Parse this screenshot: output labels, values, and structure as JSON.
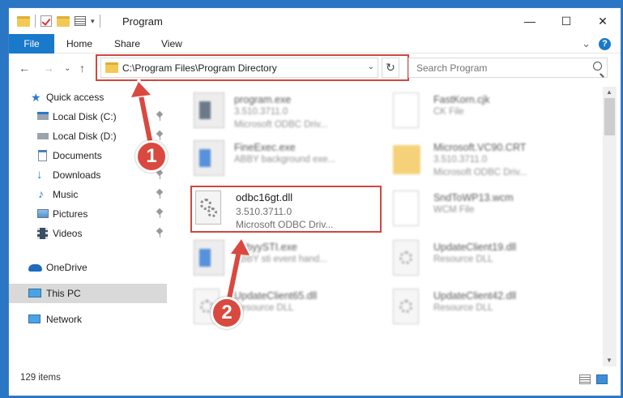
{
  "window": {
    "title": "Program",
    "minimize": "—",
    "maximize": "☐",
    "close": "✕"
  },
  "ribbon": {
    "file": "File",
    "home": "Home",
    "share": "Share",
    "view": "View",
    "expand": "⌄",
    "help": "?"
  },
  "nav": {
    "back": "←",
    "forward": "→",
    "recent": "⌄",
    "up": "↑",
    "address": "C:\\Program Files\\Program Directory",
    "address_dropdown": "⌄",
    "refresh": "↻",
    "search_placeholder": "Search Program"
  },
  "sidebar": {
    "items": [
      {
        "label": "Quick access",
        "icon": "star-icon",
        "pinned": false
      },
      {
        "label": "Local Disk (C:)",
        "icon": "drive-icon",
        "pinned": true
      },
      {
        "label": "Local Disk (D:)",
        "icon": "drive-icon",
        "pinned": true
      },
      {
        "label": "Documents",
        "icon": "documents-icon",
        "pinned": true
      },
      {
        "label": "Downloads",
        "icon": "download-icon",
        "pinned": true
      },
      {
        "label": "Music",
        "icon": "music-icon",
        "pinned": true
      },
      {
        "label": "Pictures",
        "icon": "pictures-icon",
        "pinned": true
      },
      {
        "label": "Videos",
        "icon": "videos-icon",
        "pinned": true
      },
      {
        "label": "OneDrive",
        "icon": "cloud-icon",
        "pinned": false
      },
      {
        "label": "This PC",
        "icon": "computer-icon",
        "pinned": false,
        "selected": true
      },
      {
        "label": "Network",
        "icon": "network-icon",
        "pinned": false
      }
    ]
  },
  "files": [
    {
      "name": "program.exe",
      "line2": "3.510.3711.0",
      "line3": "Microsoft ODBC Driv...",
      "icon": "app-icon"
    },
    {
      "name": "FastKorn.cjk",
      "line2": "CK File",
      "line3": "",
      "icon": "document-icon"
    },
    {
      "name": "FineExec.exe",
      "line2": "ABBY background exe...",
      "line3": "",
      "icon": "app-icon"
    },
    {
      "name": "Microsoft.VC90.CRT",
      "line2": "3.510.3711.0",
      "line3": "Microsoft ODBC Driv...",
      "icon": "folder-icon"
    },
    {
      "name": "odbc16gt.dll",
      "line2": "3.510.3711.0",
      "line3": "Microsoft ODBC Driv...",
      "icon": "dll-icon"
    },
    {
      "name": "SndToWP13.wcm",
      "line2": "WCM File",
      "line3": "",
      "icon": "document-icon"
    },
    {
      "name": "AbbyySTI.exe",
      "line2": "ABBY sti event hand...",
      "line3": "",
      "icon": "app-icon"
    },
    {
      "name": "UpdateClient19.dll",
      "line2": "Resource DLL",
      "line3": "",
      "icon": "dll-icon"
    },
    {
      "name": "UpdateClient65.dll",
      "line2": "Resource DLL",
      "line3": "",
      "icon": "dll-icon"
    },
    {
      "name": "UpdateClient42.dll",
      "line2": "Resource DLL",
      "line3": "",
      "icon": "dll-icon"
    }
  ],
  "status": {
    "count": "129 items"
  },
  "annotations": {
    "step1": "1",
    "step2": "2",
    "highlight_color": "#d0473e"
  },
  "colors": {
    "accent": "#1979ca",
    "selected": "#d9d9d9"
  }
}
